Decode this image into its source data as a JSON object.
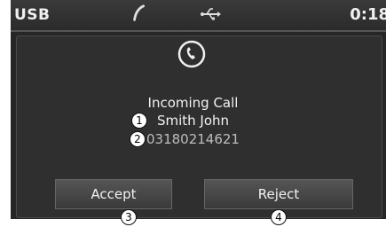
{
  "statusbar": {
    "source": "USB",
    "time": "0:18",
    "phone_icon": "phone-handset-icon",
    "usb_icon": "usb-icon"
  },
  "call": {
    "icon": "incoming-call-icon",
    "title": "Incoming Call",
    "caller_name": "Smith John",
    "caller_number": "03180214621"
  },
  "buttons": {
    "accept": "Accept",
    "reject": "Reject"
  },
  "callouts": {
    "name": "1",
    "number": "2",
    "accept": "3",
    "reject": "4"
  }
}
